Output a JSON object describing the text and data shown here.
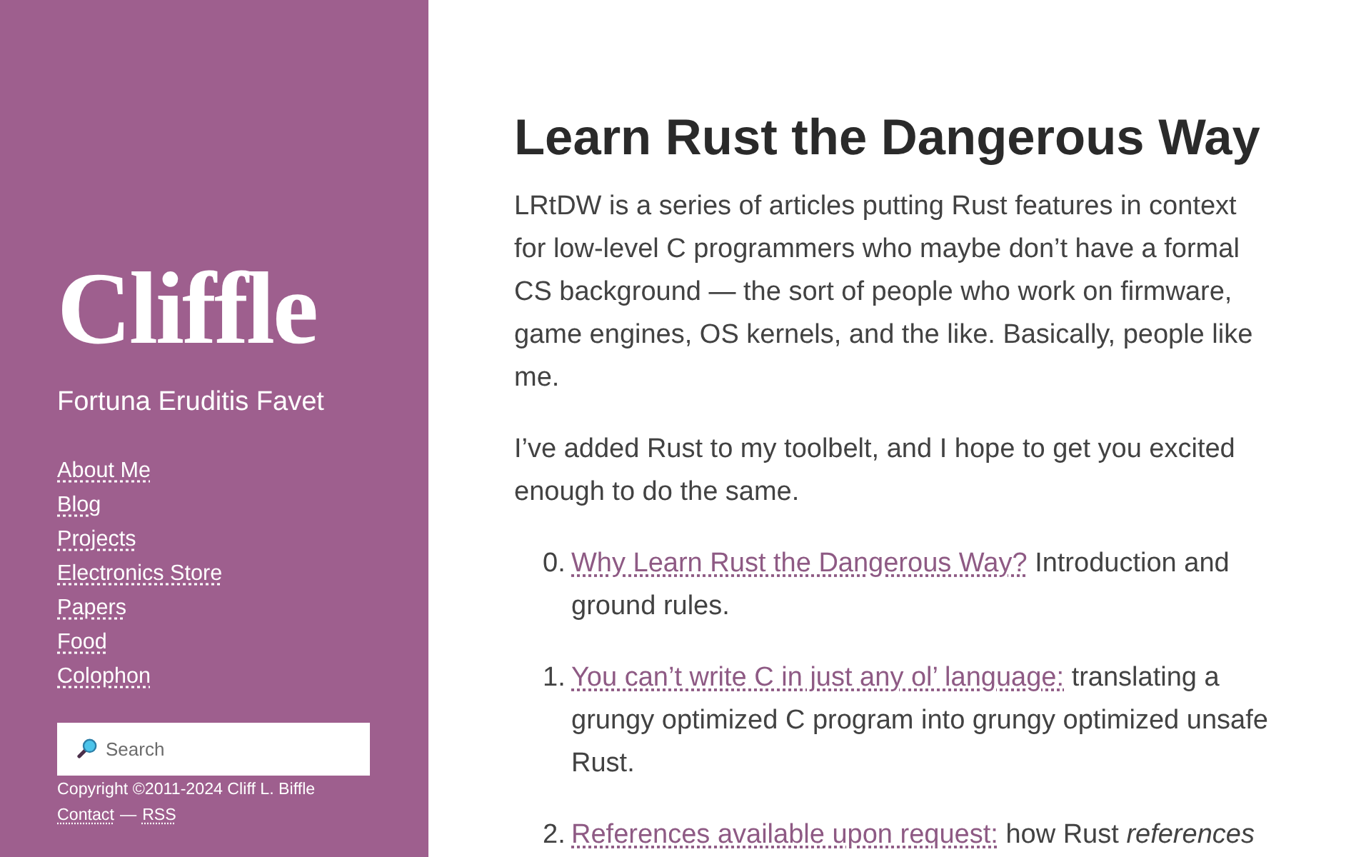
{
  "sidebar": {
    "logo": "Cliffle",
    "tagline": "Fortuna Eruditis Favet",
    "nav": [
      "About Me",
      "Blog",
      "Projects",
      "Electronics Store",
      "Papers",
      "Food",
      "Colophon"
    ],
    "search": {
      "placeholder": "Search"
    },
    "footer": {
      "copyright": "Copyright ©2011-2024 Cliff L. Biffle",
      "links": [
        "Contact",
        "RSS"
      ],
      "separator": "—"
    }
  },
  "main": {
    "title": "Learn Rust the Dangerous Way",
    "paragraphs": [
      "LRtDW is a series of articles putting Rust features in context for low-level C programmers who maybe don’t have a formal CS background — the sort of people who work on firmware, game engines, OS kernels, and the like. Basically, people like me.",
      "I’ve added Rust to my toolbelt, and I hope to get you excited enough to do the same."
    ],
    "articles": [
      {
        "number": "0.",
        "link": "Why Learn Rust the Dangerous Way?",
        "text": "Introduction and ground rules."
      },
      {
        "number": "1.",
        "link": "You can’t write C in just any ol’ language:",
        "text": "translating a grungy optimized C program into grungy optimized unsafe Rust."
      },
      {
        "number": "2.",
        "link": "References available upon request:",
        "text": "how Rust *references*"
      }
    ]
  }
}
